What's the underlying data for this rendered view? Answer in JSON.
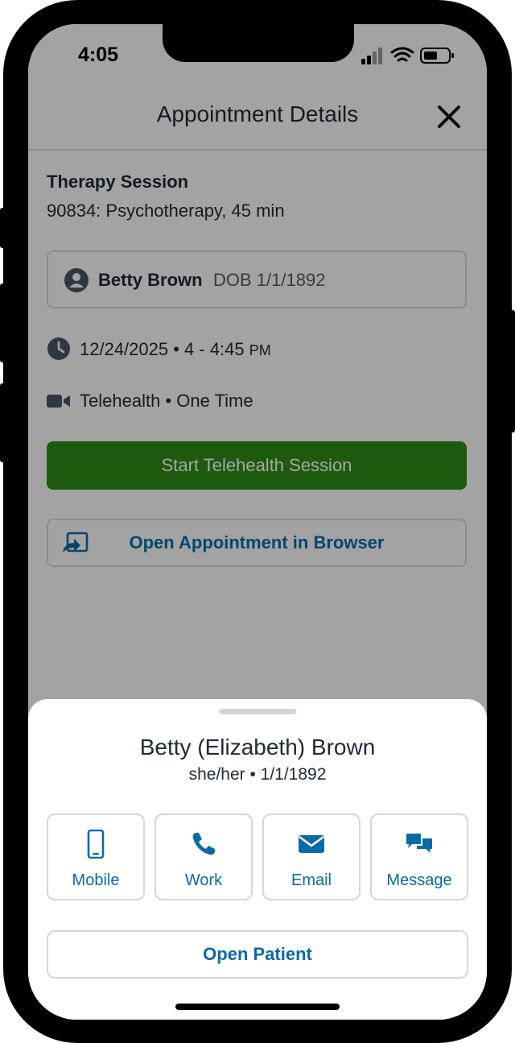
{
  "status_bar": {
    "time": "4:05"
  },
  "header": {
    "title": "Appointment Details"
  },
  "appointment": {
    "type": "Therapy Session",
    "code": "90834: Psychotherapy, 45 min",
    "patient_name": "Betty Brown",
    "patient_dob": "DOB 1/1/1892",
    "date_time": "12/24/2025 • 4 - 4:45",
    "am_pm": "PM",
    "location": "Telehealth • One Time",
    "start_label": "Start Telehealth Session",
    "browser_label": "Open Appointment in Browser"
  },
  "sheet": {
    "name": "Betty (Elizabeth) Brown",
    "subtitle": "she/her • 1/1/1892",
    "contacts": [
      {
        "label": "Mobile",
        "icon": "mobile-phone-icon"
      },
      {
        "label": "Work",
        "icon": "phone-icon"
      },
      {
        "label": "Email",
        "icon": "envelope-icon"
      },
      {
        "label": "Message",
        "icon": "chat-bubbles-icon"
      }
    ],
    "open_patient_label": "Open Patient"
  },
  "colors": {
    "accent_green": "#2e8b16",
    "link_blue": "#0a6aa6",
    "text_dark": "#1f2937"
  }
}
